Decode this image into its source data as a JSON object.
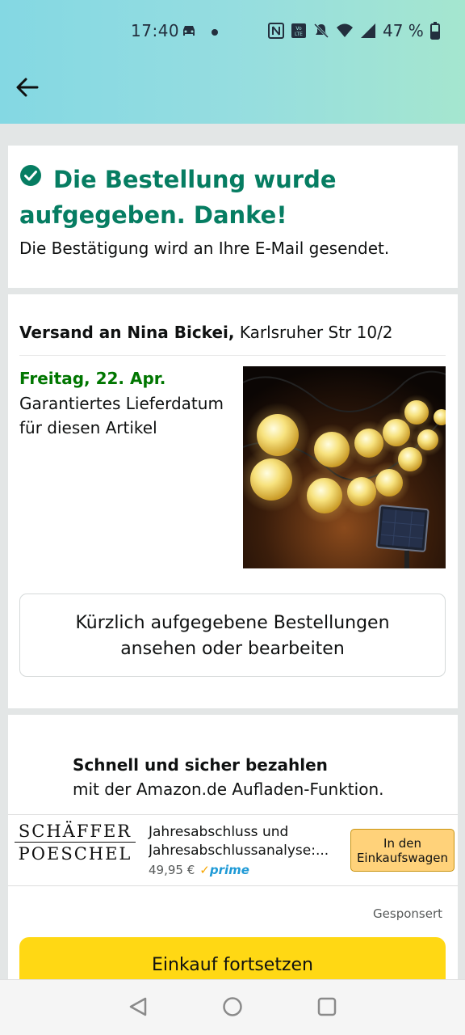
{
  "status_bar": {
    "time": "17:40",
    "battery": "47 %",
    "icons": [
      "car-icon",
      "notification-dot",
      "nfc-icon",
      "volte-icon",
      "mute-icon",
      "wifi-icon",
      "signal-icon",
      "battery-icon"
    ]
  },
  "header": {
    "back_icon": "arrow-left-icon",
    "bg_start": "#84d8e3",
    "bg_end": "#a5e6cf"
  },
  "confirmation": {
    "title_line1": "Die Bestellung wurde",
    "title_line2": "aufgegeben. Danke!",
    "subtitle": "Die Bestätigung wird an Ihre E-Mail gesendet.",
    "color": "#067d62"
  },
  "shipment": {
    "label": "Versand an Nina Bickei,",
    "address": "Karlsruher Str 10/2",
    "date": "Freitag, 22. Apr.",
    "guarantee": "Garantiertes Lieferdatum für diesen Artikel",
    "date_color": "#007600",
    "orders_button_line1": "Kürzlich aufgegebene Bestellungen",
    "orders_button_line2": "ansehen oder bearbeiten"
  },
  "promo": {
    "heading": "Schnell und sicher bezahlen",
    "text": "mit der Amazon.de Aufladen-Funktion."
  },
  "ad": {
    "brand_line1": "SCHÄFFER",
    "brand_line2": "POESCHEL",
    "title_line1": "Jahresabschluss und",
    "title_line2": "Jahresabschlussanalyse:...",
    "price": "49,95 €",
    "prime": "prime",
    "cart_button_line1": "In den",
    "cart_button_line2": "Einkaufswagen",
    "sponsored": "Gesponsert"
  },
  "continue_button": "Einkauf fortsetzen",
  "nav": {
    "back": "back-triangle-icon",
    "home": "home-circle-icon",
    "recents": "recents-square-icon"
  }
}
